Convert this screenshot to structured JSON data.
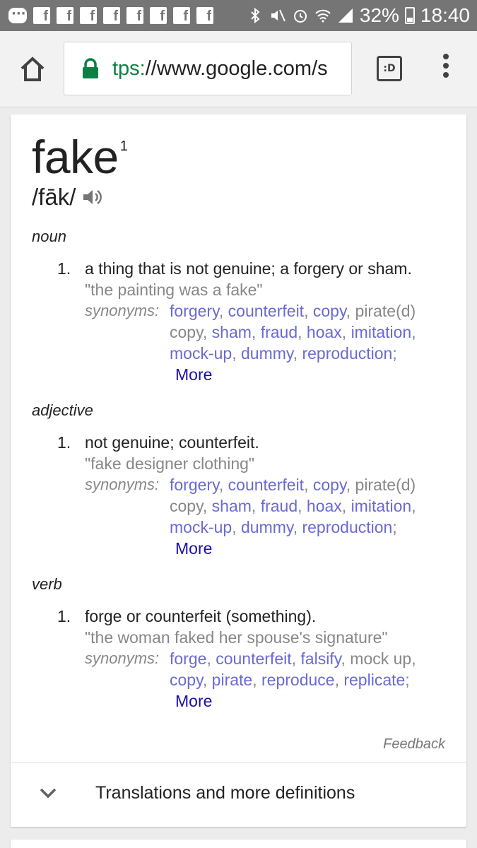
{
  "status_bar": {
    "battery": "32%",
    "time": "18:40",
    "notification_icons": [
      "message-icon",
      "facebook-icon",
      "facebook-icon",
      "facebook-icon",
      "facebook-icon",
      "facebook-icon",
      "facebook-icon",
      "facebook-icon",
      "facebook-icon"
    ],
    "system_icons": [
      "bluetooth-icon",
      "mute-icon",
      "alarm-icon",
      "wifi-icon",
      "signal-icon",
      "battery-icon"
    ]
  },
  "browser": {
    "url_scheme": "tps:",
    "url_host": "//www.google.com/s",
    "tab_count": ":D"
  },
  "entry": {
    "word": "fake",
    "homograph": "1",
    "pronunciation": "/fāk/",
    "senses": [
      {
        "pos": "noun",
        "number": "1.",
        "definition": "a thing that is not genuine; a forgery or sham.",
        "example": "\"the painting was a fake\"",
        "synonyms_label": "synonyms:",
        "synonym_lines": [
          [
            {
              "t": "forgery",
              "l": true
            },
            {
              "t": ", ",
              "l": false
            },
            {
              "t": "counterfeit",
              "l": true
            },
            {
              "t": ", ",
              "l": false
            },
            {
              "t": "copy",
              "l": true
            },
            {
              "t": ", pirate(d)",
              "l": false
            }
          ],
          [
            {
              "t": "copy, ",
              "l": false
            },
            {
              "t": "sham",
              "l": true
            },
            {
              "t": ", ",
              "l": false
            },
            {
              "t": "fraud",
              "l": true
            },
            {
              "t": ", ",
              "l": false
            },
            {
              "t": "hoax",
              "l": true
            },
            {
              "t": ", ",
              "l": false
            },
            {
              "t": "imitation",
              "l": true
            },
            {
              "t": ",",
              "l": false
            }
          ],
          [
            {
              "t": "mock-up",
              "l": true
            },
            {
              "t": ", ",
              "l": false
            },
            {
              "t": "dummy",
              "l": true
            },
            {
              "t": ", ",
              "l": false
            },
            {
              "t": "reproduction",
              "l": true
            },
            {
              "t": ";",
              "l": false
            }
          ]
        ],
        "more": "More"
      },
      {
        "pos": "adjective",
        "number": "1.",
        "definition": "not genuine; counterfeit.",
        "example": "\"fake designer clothing\"",
        "synonyms_label": "synonyms:",
        "synonym_lines": [
          [
            {
              "t": "forgery",
              "l": true
            },
            {
              "t": ", ",
              "l": false
            },
            {
              "t": "counterfeit",
              "l": true
            },
            {
              "t": ", ",
              "l": false
            },
            {
              "t": "copy",
              "l": true
            },
            {
              "t": ", pirate(d)",
              "l": false
            }
          ],
          [
            {
              "t": "copy, ",
              "l": false
            },
            {
              "t": "sham",
              "l": true
            },
            {
              "t": ", ",
              "l": false
            },
            {
              "t": "fraud",
              "l": true
            },
            {
              "t": ", ",
              "l": false
            },
            {
              "t": "hoax",
              "l": true
            },
            {
              "t": ", ",
              "l": false
            },
            {
              "t": "imitation",
              "l": true
            },
            {
              "t": ",",
              "l": false
            }
          ],
          [
            {
              "t": "mock-up",
              "l": true
            },
            {
              "t": ", ",
              "l": false
            },
            {
              "t": "dummy",
              "l": true
            },
            {
              "t": ", ",
              "l": false
            },
            {
              "t": "reproduction",
              "l": true
            },
            {
              "t": ";",
              "l": false
            }
          ]
        ],
        "more": "More"
      },
      {
        "pos": "verb",
        "number": "1.",
        "definition": "forge or counterfeit (something).",
        "example": "\"the woman faked her spouse's signature\"",
        "synonyms_label": "synonyms:",
        "synonym_lines": [
          [
            {
              "t": "forge",
              "l": true
            },
            {
              "t": ", ",
              "l": false
            },
            {
              "t": "counterfeit",
              "l": true
            },
            {
              "t": ", ",
              "l": false
            },
            {
              "t": "falsify",
              "l": true
            },
            {
              "t": ", mock up,",
              "l": false
            }
          ],
          [
            {
              "t": "copy",
              "l": true
            },
            {
              "t": ", ",
              "l": false
            },
            {
              "t": "pirate",
              "l": true
            },
            {
              "t": ", ",
              "l": false
            },
            {
              "t": "reproduce",
              "l": true
            },
            {
              "t": ", ",
              "l": false
            },
            {
              "t": "replicate",
              "l": true
            },
            {
              "t": ";",
              "l": false
            }
          ]
        ],
        "more": "More"
      }
    ],
    "feedback": "Feedback",
    "translations_label": "Translations and more definitions"
  },
  "colors": {
    "link": "#6a6ad4",
    "more_link": "#1a0dab",
    "secure_green": "#0b8043",
    "status_bar": "#757575"
  }
}
